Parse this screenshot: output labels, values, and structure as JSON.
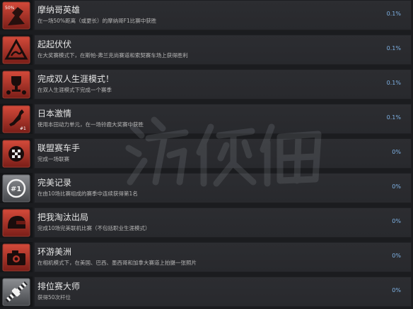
{
  "achievements": [
    {
      "title": "摩纳哥英雄",
      "desc": "在一场50%距离（或更长）的摩纳哥F1比赛中获胜",
      "pct": "0.1%",
      "icon": "monaco-50-icon",
      "badge": "50%"
    },
    {
      "title": "起起伏伏",
      "desc": "在大奖赛模式下，在斯帕-弗兰克尚赛道和索契赛车场上获得胜利",
      "pct": "0.1%",
      "icon": "road-warning-icon"
    },
    {
      "title": "完成双人生涯模式！",
      "desc": "在双人生涯模式下完成一个赛季",
      "pct": "0.1%",
      "icon": "trophy-icon"
    },
    {
      "title": "日本激情",
      "desc": "使用本田动力单元，在一场铃鹿大奖赛中获胜",
      "pct": "0.1%",
      "icon": "japan-map-icon",
      "badge": "#1"
    },
    {
      "title": "联盟赛车手",
      "desc": "完成一场联赛",
      "pct": "0%",
      "icon": "checkered-flag-icon"
    },
    {
      "title": "完美记录",
      "desc": "在由10场比赛组成的赛季中连续获得第1名",
      "pct": "0%",
      "icon": "first-place-icon",
      "badge": "#1"
    },
    {
      "title": "把我淘汰出局",
      "desc": "完成10场完美联机比赛（不包括职业生涯模式）",
      "pct": "0%",
      "icon": "helmet-icon"
    },
    {
      "title": "环游美洲",
      "desc": "在相机模式下，在美国、巴西、墨西哥和加拿大赛道上拍摄一张照片",
      "pct": "0%",
      "icon": "camera-icon"
    },
    {
      "title": "排位赛大师",
      "desc": "获得50次杆位",
      "pct": "0%",
      "icon": "grid-car-icon"
    }
  ],
  "watermark": {
    "text": "游侠网"
  },
  "colors": {
    "background": "#1b1c1f",
    "panel": "#2c2d31",
    "percent": "#7fb2e5",
    "icon_accent": "#c0392b"
  }
}
